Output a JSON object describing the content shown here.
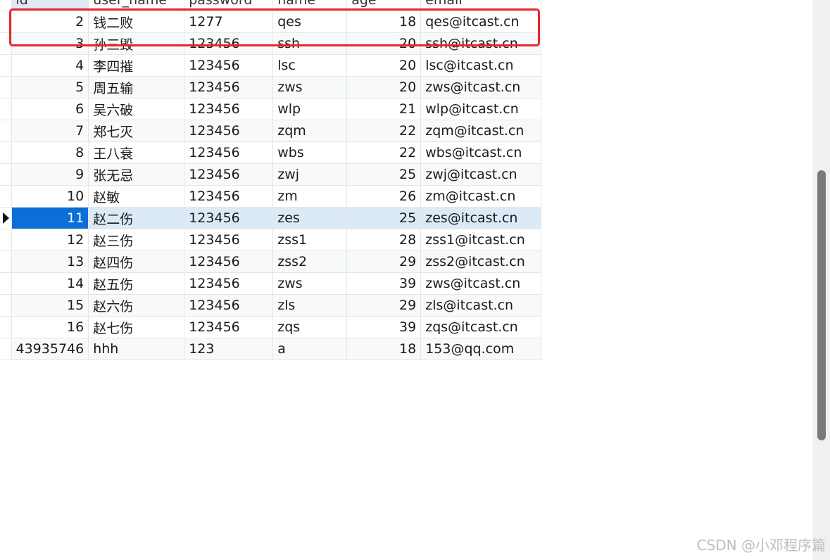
{
  "columns": [
    "id",
    "user_name",
    "password",
    "name",
    "age",
    "email"
  ],
  "rows": [
    {
      "id": "2",
      "user_name": "钱二败",
      "password": "1277",
      "name": "qes",
      "age": "18",
      "email": "qes@itcast.cn"
    },
    {
      "id": "3",
      "user_name": "孙三毁",
      "password": "123456",
      "name": "ssh",
      "age": "20",
      "email": "ssh@itcast.cn"
    },
    {
      "id": "4",
      "user_name": "李四摧",
      "password": "123456",
      "name": "lsc",
      "age": "20",
      "email": "lsc@itcast.cn"
    },
    {
      "id": "5",
      "user_name": "周五输",
      "password": "123456",
      "name": "zws",
      "age": "20",
      "email": "zws@itcast.cn"
    },
    {
      "id": "6",
      "user_name": "吴六破",
      "password": "123456",
      "name": "wlp",
      "age": "21",
      "email": "wlp@itcast.cn"
    },
    {
      "id": "7",
      "user_name": "郑七灭",
      "password": "123456",
      "name": "zqm",
      "age": "22",
      "email": "zqm@itcast.cn"
    },
    {
      "id": "8",
      "user_name": "王八衰",
      "password": "123456",
      "name": "wbs",
      "age": "22",
      "email": "wbs@itcast.cn"
    },
    {
      "id": "9",
      "user_name": "张无忌",
      "password": "123456",
      "name": "zwj",
      "age": "25",
      "email": "zwj@itcast.cn"
    },
    {
      "id": "10",
      "user_name": "赵敏",
      "password": "123456",
      "name": "zm",
      "age": "26",
      "email": "zm@itcast.cn"
    },
    {
      "id": "11",
      "user_name": "赵二伤",
      "password": "123456",
      "name": "zes",
      "age": "25",
      "email": "zes@itcast.cn"
    },
    {
      "id": "12",
      "user_name": "赵三伤",
      "password": "123456",
      "name": "zss1",
      "age": "28",
      "email": "zss1@itcast.cn"
    },
    {
      "id": "13",
      "user_name": "赵四伤",
      "password": "123456",
      "name": "zss2",
      "age": "29",
      "email": "zss2@itcast.cn"
    },
    {
      "id": "14",
      "user_name": "赵五伤",
      "password": "123456",
      "name": "zws",
      "age": "39",
      "email": "zws@itcast.cn"
    },
    {
      "id": "15",
      "user_name": "赵六伤",
      "password": "123456",
      "name": "zls",
      "age": "29",
      "email": "zls@itcast.cn"
    },
    {
      "id": "16",
      "user_name": "赵七伤",
      "password": "123456",
      "name": "zqs",
      "age": "39",
      "email": "zqs@itcast.cn"
    },
    {
      "id": "43935746",
      "user_name": "hhh",
      "password": "123",
      "name": "a",
      "age": "18",
      "email": "153@qq.com"
    }
  ],
  "selected_row_id": "11",
  "watermark": "CSDN @小邓程序篇",
  "colors": {
    "highlight": "#e8262c",
    "selection": "#0a6fd6",
    "selection_row": "#dceaf7"
  }
}
